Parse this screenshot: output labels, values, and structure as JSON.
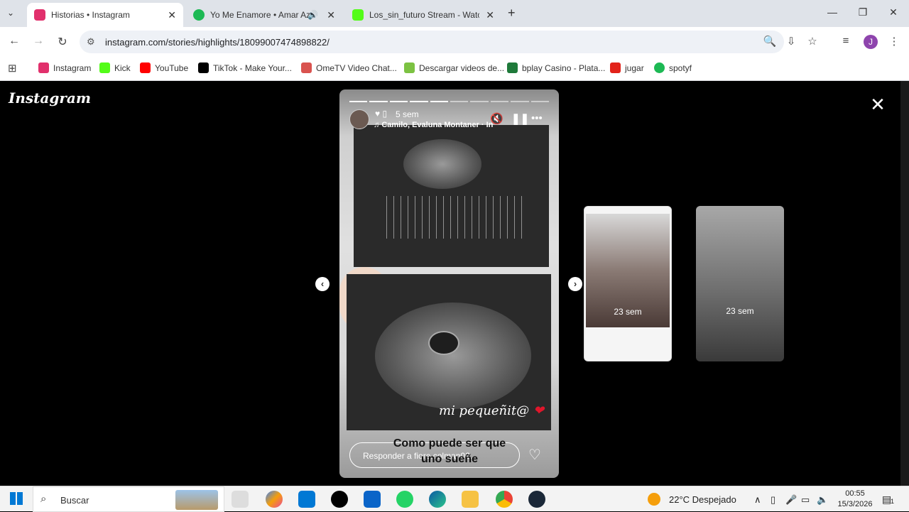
{
  "browser": {
    "tabs": [
      {
        "title": "Historias • Instagram",
        "active": true,
        "color": "#e1306c"
      },
      {
        "title": "Yo Me Enamore • Amar Azu",
        "active": false,
        "color": "#1db954"
      },
      {
        "title": "Los_sin_futuro Stream - Watch",
        "active": false,
        "color": "#53fc18"
      }
    ],
    "url": "instagram.com/stories/highlights/18099007474898822/",
    "bookmarks": [
      {
        "label": "Instagram",
        "color": "#e1306c"
      },
      {
        "label": "Kick",
        "color": "#53fc18"
      },
      {
        "label": "YouTube",
        "color": "#ff0000"
      },
      {
        "label": "TikTok - Make Your...",
        "color": "#000000"
      },
      {
        "label": "OmeTV Video Chat...",
        "color": "#d9534f"
      },
      {
        "label": "Descargar videos de...",
        "color": "#7cc242"
      },
      {
        "label": "bplay Casino - Plata...",
        "color": "#1f7a3a"
      },
      {
        "label": "jugar",
        "color": "#e2231a"
      },
      {
        "label": "spotyf",
        "color": "#1db954"
      }
    ],
    "profile_initial": "J",
    "profile_color": "#8e44ad"
  },
  "page": {
    "logo": "Instagram",
    "close_label": "✕"
  },
  "story": {
    "time": "5 sem",
    "music": "Camilo, Evaluna Montaner · In",
    "overlay_text": "mi pequeñit@",
    "caption_line1": "Como puede ser que",
    "caption_line2": "uno sueñe",
    "reply_placeholder": "Responder a fiore.colman02...",
    "progress_total": 10,
    "progress_done": 5
  },
  "previews": [
    {
      "label": "23 sem",
      "bg": "#cfcfcf"
    },
    {
      "label": "23 sem",
      "bg": "#8a8a8a"
    }
  ],
  "taskbar": {
    "search_placeholder": "Buscar",
    "weather": "22°C  Despejado",
    "time": "00:55",
    "date": "15/3/2026",
    "notification_count": "1"
  }
}
